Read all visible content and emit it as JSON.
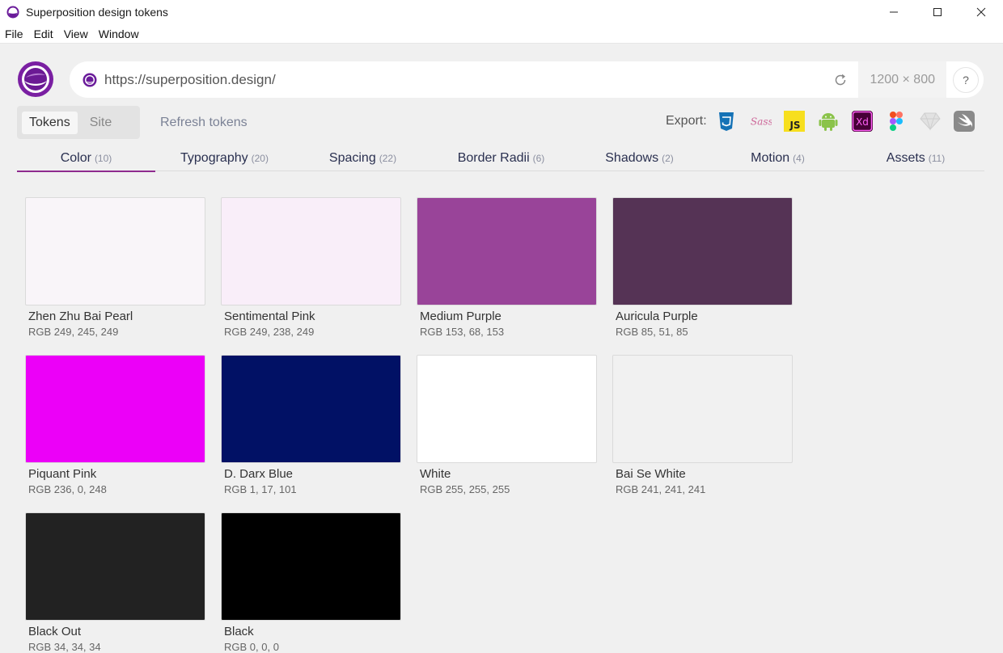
{
  "window": {
    "title": "Superposition design tokens"
  },
  "menu": [
    "File",
    "Edit",
    "View",
    "Window"
  ],
  "urlbar": {
    "url": "https://superposition.design/",
    "dimensions": "1200 × 800",
    "help": "?"
  },
  "mode": {
    "tokens": "Tokens",
    "site": "Site",
    "refresh": "Refresh tokens"
  },
  "export": {
    "label": "Export:",
    "icons": [
      "css3-icon",
      "sass-icon",
      "js-icon",
      "android-icon",
      "xd-icon",
      "figma-icon",
      "sketch-icon",
      "swift-icon"
    ]
  },
  "tabs": [
    {
      "label": "Color",
      "count": "(10)"
    },
    {
      "label": "Typography",
      "count": "(20)"
    },
    {
      "label": "Spacing",
      "count": "(22)"
    },
    {
      "label": "Border Radii",
      "count": "(6)"
    },
    {
      "label": "Shadows",
      "count": "(2)"
    },
    {
      "label": "Motion",
      "count": "(4)"
    },
    {
      "label": "Assets",
      "count": "(11)"
    }
  ],
  "colors": [
    {
      "name": "Zhen Zhu Bai Pearl",
      "rgb": "RGB 249, 245, 249",
      "hex": "#f9f5f9"
    },
    {
      "name": "Sentimental Pink",
      "rgb": "RGB 249, 238, 249",
      "hex": "#f9eef9"
    },
    {
      "name": "Medium Purple",
      "rgb": "RGB 153, 68, 153",
      "hex": "#994499"
    },
    {
      "name": "Auricula Purple",
      "rgb": "RGB 85, 51, 85",
      "hex": "#553355"
    },
    {
      "name": "Piquant Pink",
      "rgb": "RGB 236, 0, 248",
      "hex": "#ec00f8"
    },
    {
      "name": "D. Darx Blue",
      "rgb": "RGB 1, 17, 101",
      "hex": "#011165"
    },
    {
      "name": "White",
      "rgb": "RGB 255, 255, 255",
      "hex": "#ffffff"
    },
    {
      "name": "Bai Se White",
      "rgb": "RGB 241, 241, 241",
      "hex": "#f1f1f1"
    },
    {
      "name": "Black Out",
      "rgb": "RGB 34, 34, 34",
      "hex": "#222222"
    },
    {
      "name": "Black",
      "rgb": "RGB 0, 0, 0",
      "hex": "#000000"
    }
  ],
  "accent": "#8e2a8e"
}
